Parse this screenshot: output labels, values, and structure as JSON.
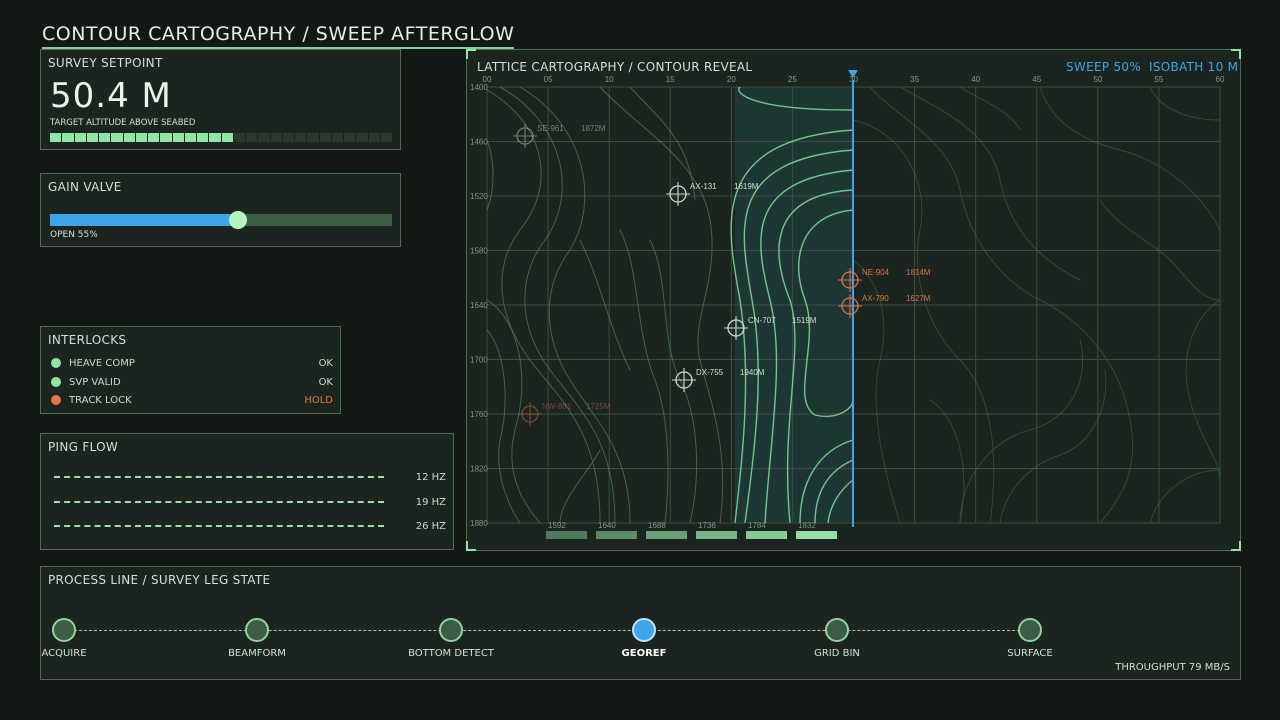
{
  "title": "CONTOUR CARTOGRAPHY / SWEEP AFTERGLOW",
  "colors": {
    "bg": "#131815",
    "panel": "#1b241e",
    "accent": "#8fe6a6",
    "sweep": "#3ea6e6",
    "warn": "#e8744a"
  },
  "survey": {
    "header": "SURVEY SETPOINT",
    "value": "50.4 M",
    "sub": "TARGET ALTITUDE ABOVE SEABED",
    "segments_total": 28,
    "segments_on": 15
  },
  "gain": {
    "header": "GAIN VALVE",
    "label": "OPEN 55%",
    "level": 0.55
  },
  "interlocks": {
    "header": "INTERLOCKS",
    "items": [
      {
        "name": "HEAVE COMP",
        "status": "OK",
        "color": "#8fe6a6"
      },
      {
        "name": "SVP VALID",
        "status": "OK",
        "color": "#8fe6a6"
      },
      {
        "name": "TRACK LOCK",
        "status": "HOLD",
        "color": "#e8744a"
      }
    ]
  },
  "ping": {
    "header": "PING FLOW",
    "rows": [
      {
        "rate": "12 HZ"
      },
      {
        "rate": "19 HZ"
      },
      {
        "rate": "26 HZ"
      }
    ]
  },
  "map": {
    "header": "LATTICE CARTOGRAPHY / CONTOUR REVEAL",
    "sweep": "SWEEP 50%",
    "isobath": "ISOBATH 10 M",
    "sweep_level": 0.5,
    "x_ticks": [
      "00",
      "05",
      "10",
      "15",
      "20",
      "25",
      "30",
      "35",
      "40",
      "45",
      "50",
      "55",
      "60"
    ],
    "y_ticks": [
      "1400",
      "1460",
      "1520",
      "1580",
      "1640",
      "1700",
      "1760",
      "1820",
      "1880"
    ],
    "bottom_labels": [
      "1592",
      "1640",
      "1688",
      "1736",
      "1784",
      "1832"
    ],
    "targets": [
      {
        "id": "SE-961",
        "depth": "1872M",
        "color": "white",
        "dim": true
      },
      {
        "id": "AX-131",
        "depth": "1619M",
        "color": "white",
        "dim": false
      },
      {
        "id": "NE-904",
        "depth": "1814M",
        "color": "orange",
        "dim": false
      },
      {
        "id": "AX-790",
        "depth": "1627M",
        "color": "orange",
        "dim": false
      },
      {
        "id": "CN-707",
        "depth": "1519M",
        "color": "white",
        "dim": false
      },
      {
        "id": "DX-755",
        "depth": "1940M",
        "color": "white",
        "dim": false
      },
      {
        "id": "NW-881",
        "depth": "1725M",
        "color": "orange",
        "dim": true
      }
    ]
  },
  "process": {
    "header": "PROCESS LINE / SURVEY LEG STATE",
    "throughput": "THROUGHPUT 79 MB/S",
    "stages": [
      {
        "label": "ACQUIRE",
        "active": false
      },
      {
        "label": "BEAMFORM",
        "active": false
      },
      {
        "label": "BOTTOM DETECT",
        "active": false
      },
      {
        "label": "GEOREF",
        "active": true
      },
      {
        "label": "GRID BIN",
        "active": false
      },
      {
        "label": "SURFACE",
        "active": false
      }
    ]
  }
}
